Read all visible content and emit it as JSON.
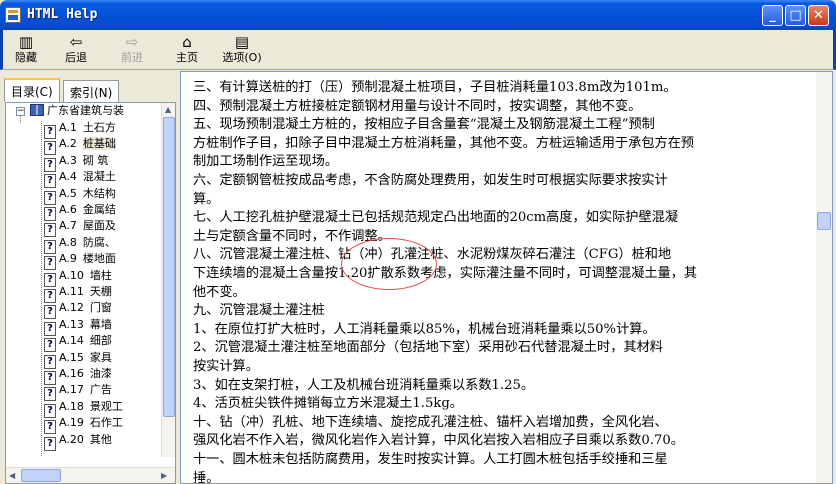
{
  "window": {
    "title": "HTML Help"
  },
  "toolbar": {
    "hide": "隐藏",
    "back": "后退",
    "forward": "前进",
    "home": "主页",
    "options": "选项(O)"
  },
  "tabs": {
    "contents": "目录(C)",
    "index": "索引(N)"
  },
  "tree": {
    "root": "广东省建筑与装",
    "items": [
      {
        "code": "A.1",
        "label": "土石方"
      },
      {
        "code": "A.2",
        "label": "桩基础"
      },
      {
        "code": "A.3",
        "label": "砌  筑"
      },
      {
        "code": "A.4",
        "label": "混凝土"
      },
      {
        "code": "A.5",
        "label": "木结构"
      },
      {
        "code": "A.6",
        "label": "金属结"
      },
      {
        "code": "A.7",
        "label": "屋面及"
      },
      {
        "code": "A.8",
        "label": "防腐、"
      },
      {
        "code": "A.9",
        "label": "楼地面"
      },
      {
        "code": "A.10",
        "label": "墙柱"
      },
      {
        "code": "A.11",
        "label": "天棚"
      },
      {
        "code": "A.12",
        "label": "门窗"
      },
      {
        "code": "A.13",
        "label": "幕墙"
      },
      {
        "code": "A.14",
        "label": "细部"
      },
      {
        "code": "A.15",
        "label": "家具"
      },
      {
        "code": "A.16",
        "label": "油漆"
      },
      {
        "code": "A.17",
        "label": "广告"
      },
      {
        "code": "A.18",
        "label": "景观工"
      },
      {
        "code": "A.19",
        "label": "石作工"
      },
      {
        "code": "A.20",
        "label": "其他"
      }
    ]
  },
  "content": {
    "lines": [
      "    三、有计算送桩的打（压）预制混凝土桩项目，子目桩消耗量103.8m改为101m。",
      "    四、预制混凝土方桩接桩定额钢材用量与设计不同时，按实调整，其他不变。",
      "    五、现场预制混凝土方桩的，按相应子目含量套“混凝土及钢筋混凝土工程”预制",
      "方桩制作子目，扣除子目中混凝土方桩消耗量，其他不变。方桩运输适用于承包方在预",
      "制加工场制作运至现场。",
      "    六、定额钢管桩按成品考虑，不含防腐处理费用，如发生时可根据实际要求按实计",
      "算。",
      "    七、人工挖孔桩护壁混凝土已包括规范规定凸出地面的20cm高度，如实际护壁混凝",
      "土与定额含量不同时，不作调整。",
      "    八、沉管混凝土灌注桩、钻（冲）孔灌注桩、水泥粉煤灰碎石灌注（CFG）桩和地",
      "下连续墙的混凝土含量按1.20扩散系数考虑，实际灌注量不同时，可调整混凝土量，其",
      "他不变。",
      "    九、沉管混凝土灌注桩",
      "    1、在原位打扩大桩时，人工消耗量乘以85%，机械台班消耗量乘以50%计算。",
      "    2、沉管混凝土灌注桩至地面部分（包括地下室）采用砂石代替混凝土时，其材料",
      "按实计算。",
      "    3、如在支架打桩，人工及机械台班消耗量乘以系数1.25。",
      "    4、活页桩尖铁件摊销每立方米混凝土1.5kg。",
      "    十、钻（冲）孔桩、地下连续墙、旋挖成孔灌注桩、锚杆入岩增加费，全风化岩、",
      "强风化岩不作入岩，微风化岩作入岩计算，中风化岩按入岩相应子目乘以系数0.70。",
      "    十一、圆木桩未包括防腐费用，发生时按实计算。人工打圆木桩包括手绞捶和三星",
      "捶。"
    ]
  }
}
